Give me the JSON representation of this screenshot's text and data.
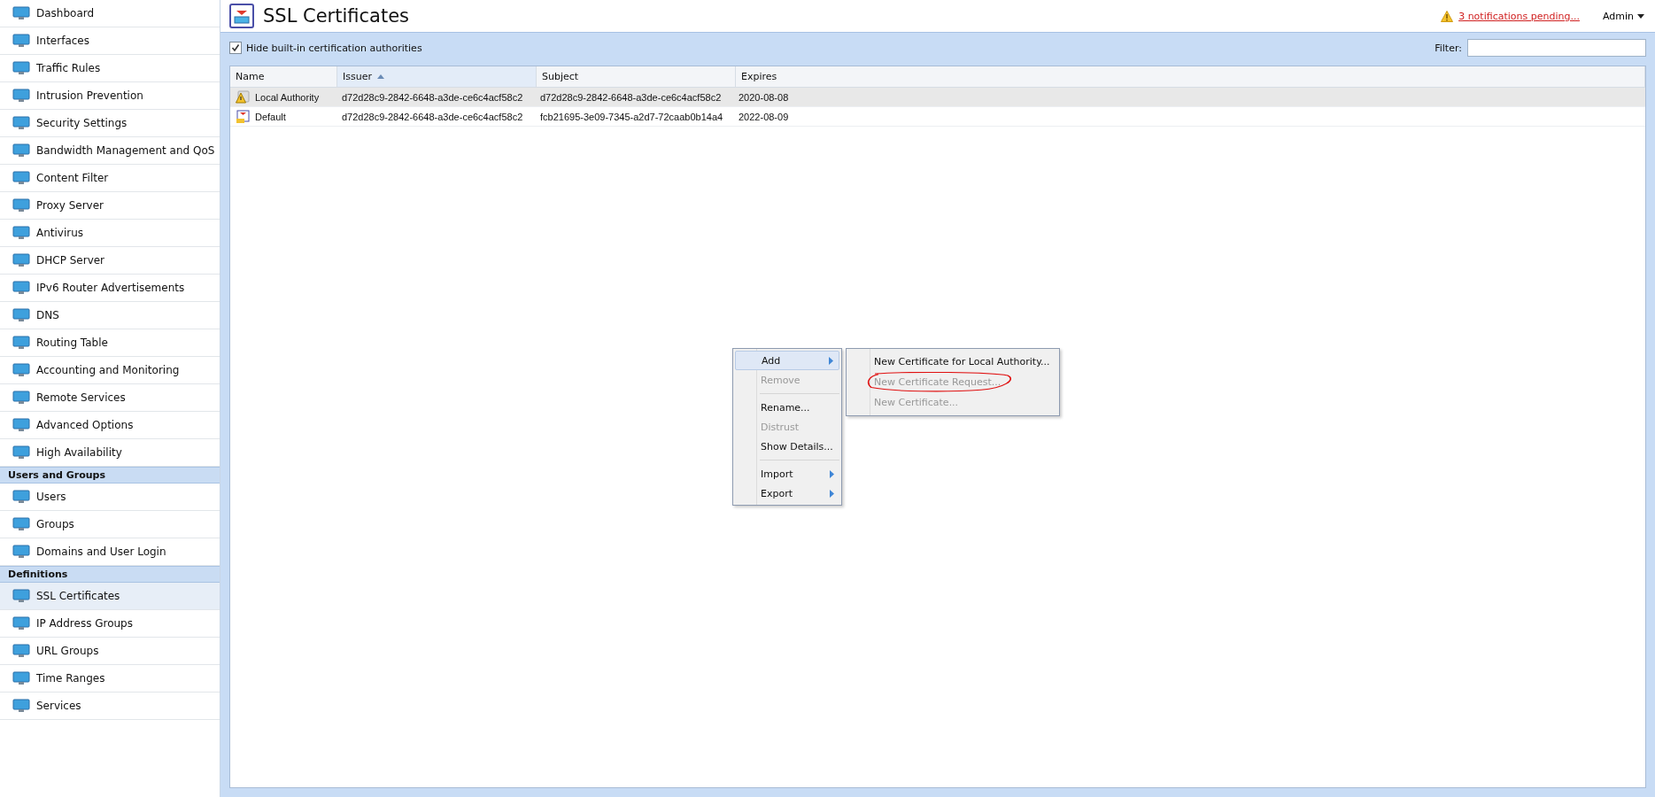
{
  "sidebar": {
    "sections": [
      {
        "items": [
          {
            "label": "Dashboard",
            "selected": false
          },
          {
            "label": "Interfaces",
            "selected": false
          },
          {
            "label": "Traffic Rules",
            "selected": false
          },
          {
            "label": "Intrusion Prevention",
            "selected": false
          },
          {
            "label": "Security Settings",
            "selected": false
          },
          {
            "label": "Bandwidth Management and QoS",
            "selected": false
          },
          {
            "label": "Content Filter",
            "selected": false
          },
          {
            "label": "Proxy Server",
            "selected": false
          },
          {
            "label": "Antivirus",
            "selected": false
          },
          {
            "label": "DHCP Server",
            "selected": false
          },
          {
            "label": "IPv6 Router Advertisements",
            "selected": false
          },
          {
            "label": "DNS",
            "selected": false
          },
          {
            "label": "Routing Table",
            "selected": false
          },
          {
            "label": "Accounting and Monitoring",
            "selected": false
          },
          {
            "label": "Remote Services",
            "selected": false
          },
          {
            "label": "Advanced Options",
            "selected": false
          },
          {
            "label": "High Availability",
            "selected": false
          }
        ]
      },
      {
        "heading": "Users and Groups",
        "items": [
          {
            "label": "Users",
            "selected": false
          },
          {
            "label": "Groups",
            "selected": false
          },
          {
            "label": "Domains and User Login",
            "selected": false
          }
        ]
      },
      {
        "heading": "Definitions",
        "items": [
          {
            "label": "SSL Certificates",
            "selected": true
          },
          {
            "label": "IP Address Groups",
            "selected": false
          },
          {
            "label": "URL Groups",
            "selected": false
          },
          {
            "label": "Time Ranges",
            "selected": false
          },
          {
            "label": "Services",
            "selected": false
          }
        ]
      }
    ]
  },
  "header": {
    "title": "SSL Certificates",
    "notifications": "3 notifications pending...",
    "user": "Admin"
  },
  "toolbar": {
    "checkbox": {
      "label": "Hide built-in certification authorities",
      "checked": true
    },
    "filter": {
      "label": "Filter:"
    }
  },
  "table": {
    "columns": [
      {
        "label": "Name",
        "sorted": false
      },
      {
        "label": "Issuer",
        "sorted": true
      },
      {
        "label": "Subject",
        "sorted": false
      },
      {
        "label": "Expires",
        "sorted": false
      }
    ],
    "rows": [
      {
        "kind": "warning",
        "selected": true,
        "cells": [
          "Local Authority",
          "d72d28c9-2842-6648-a3de-ce6c4acf58c2",
          "d72d28c9-2842-6648-a3de-ce6c4acf58c2",
          "2020-08-08"
        ]
      },
      {
        "kind": "certificate",
        "selected": false,
        "cells": [
          "Default",
          "d72d28c9-2842-6648-a3de-ce6c4acf58c2",
          "fcb21695-3e09-7345-a2d7-72caab0b14a4",
          "2022-08-09"
        ]
      }
    ]
  },
  "context_menu": {
    "items": [
      {
        "kind": "item",
        "label": "Add",
        "disabled": false,
        "submenu": true,
        "selected": true
      },
      {
        "kind": "item",
        "label": "Remove",
        "disabled": true,
        "submenu": false,
        "selected": false
      },
      {
        "kind": "separator"
      },
      {
        "kind": "item",
        "label": "Rename...",
        "disabled": false,
        "submenu": false,
        "selected": false
      },
      {
        "kind": "item",
        "label": "Distrust",
        "disabled": true,
        "submenu": false,
        "selected": false
      },
      {
        "kind": "item",
        "label": "Show Details...",
        "disabled": false,
        "submenu": false,
        "selected": false
      },
      {
        "kind": "separator"
      },
      {
        "kind": "item",
        "label": "Import",
        "disabled": false,
        "submenu": true,
        "selected": false
      },
      {
        "kind": "item",
        "label": "Export",
        "disabled": false,
        "submenu": true,
        "selected": false
      }
    ],
    "submenu": [
      {
        "label": "New Certificate for Local Authority...",
        "disabled": false,
        "circled": false
      },
      {
        "label": "New Certificate Request...",
        "disabled": true,
        "circled": true
      },
      {
        "label": "New Certificate...",
        "disabled": true,
        "circled": false
      }
    ]
  }
}
